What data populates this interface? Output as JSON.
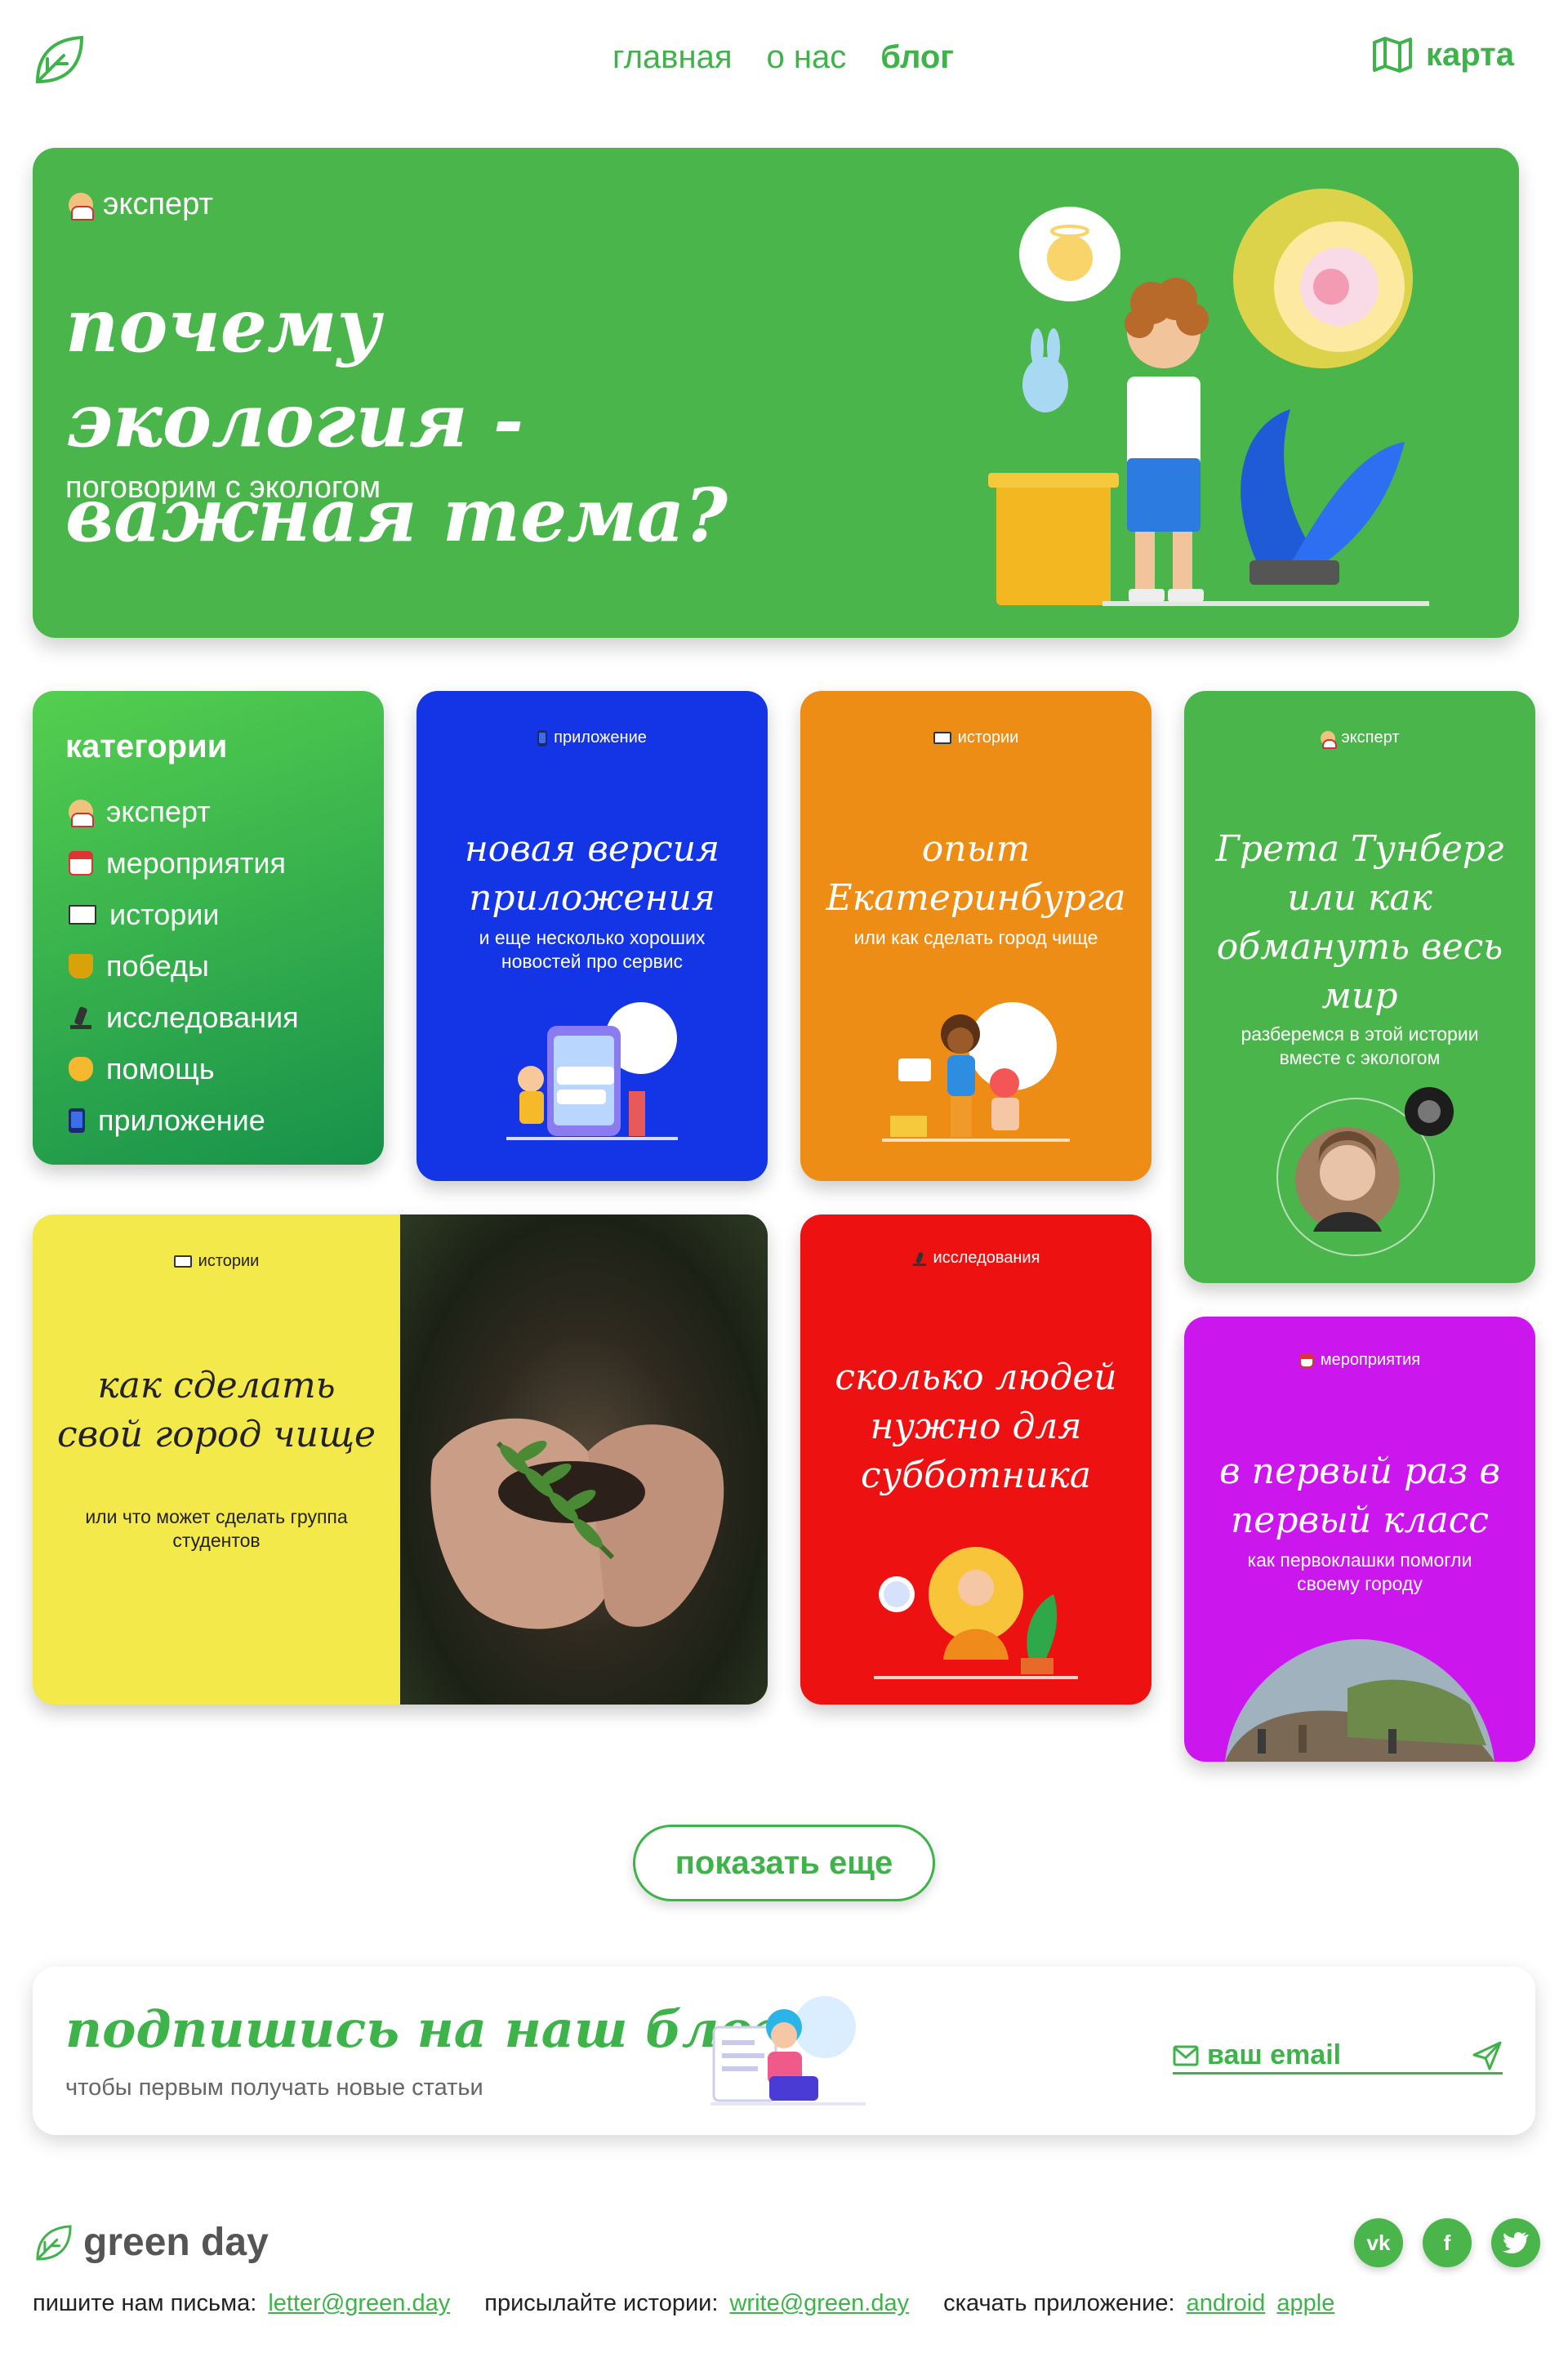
{
  "nav": {
    "items": [
      {
        "label": "главная",
        "active": false
      },
      {
        "label": "о нас",
        "active": false
      },
      {
        "label": "блог",
        "active": true
      }
    ],
    "map_label": "карта"
  },
  "hero": {
    "tag": "эксперт",
    "title": "почему экология - важная тема?",
    "subtitle": "поговорим с экологом"
  },
  "categories": {
    "title": "категории",
    "items": [
      {
        "label": "эксперт",
        "icon": "expert-icon"
      },
      {
        "label": "мероприятия",
        "icon": "calendar-icon"
      },
      {
        "label": "истории",
        "icon": "book-icon"
      },
      {
        "label": "победы",
        "icon": "trophy-icon"
      },
      {
        "label": "исследования",
        "icon": "microscope-icon"
      },
      {
        "label": "помощь",
        "icon": "helping-hand-icon"
      },
      {
        "label": "приложение",
        "icon": "phone-icon"
      }
    ]
  },
  "cards": {
    "app": {
      "tag": "приложение",
      "title": "новая версия приложения",
      "subtitle": "и еще несколько хороших новостей про сервис",
      "color": "#1335e6"
    },
    "ekb": {
      "tag": "истории",
      "title": "опыт Екатеринбурга",
      "subtitle": "или как сделать город чище",
      "color": "#ee8d15"
    },
    "greta": {
      "tag": "эксперт",
      "title": "Грета Тунберг или как обмануть весь мир",
      "subtitle": "разберемся в этой истории вместе с экологом",
      "color": "#4ab54a"
    },
    "city": {
      "tag": "истории",
      "title": "как сделать свой город чище",
      "subtitle": "или что может сделать группа студентов",
      "color": "#f3e94a"
    },
    "people": {
      "tag": "исследования",
      "title": "сколько людей нужно для субботника",
      "subtitle": "",
      "color": "#ee1111"
    },
    "first": {
      "tag": "мероприятия",
      "title": "в первый раз в первый класс",
      "subtitle": "как первоклашки помогли своему городу",
      "color": "#cc16ee"
    }
  },
  "more_button": "показать еще",
  "subscribe": {
    "title": "подпишись на наш блог",
    "text": "чтобы первым получать новые статьи",
    "email_placeholder": "ваш email"
  },
  "footer": {
    "brand": "green day",
    "letters_label": "пишите нам письма:",
    "letters_email": "letter@green.day",
    "stories_label": "присылайте истории:",
    "stories_email": "write@green.day",
    "app_label": "скачать приложение:",
    "android": "android",
    "apple": "apple",
    "socials": [
      "vk-icon",
      "facebook-icon",
      "twitter-icon"
    ]
  },
  "colors": {
    "brand_green": "#3db34a",
    "hero_green": "#4ab54a"
  }
}
